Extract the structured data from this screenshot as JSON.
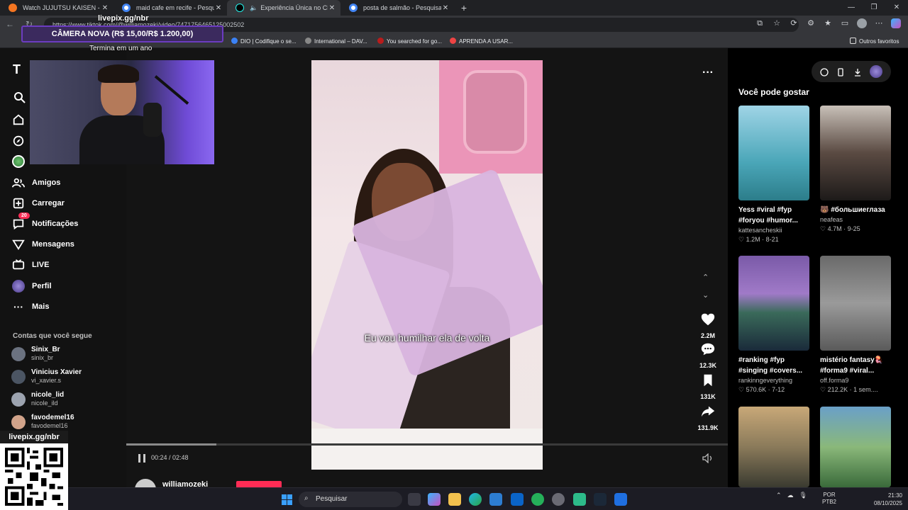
{
  "browser": {
    "tabs": [
      {
        "title": "Watch JUJUTSU KAISEN - Crunchyroll",
        "color": "#f47521",
        "active": false
      },
      {
        "title": "maid cafe em recife - Pesquisa Google",
        "color": "#4285f4",
        "active": false
      },
      {
        "title": "Experiência Única no Chest Club",
        "color": "#000000",
        "active": true
      },
      {
        "title": "posta de salmão - Pesquisa Google",
        "color": "#4285f4",
        "active": false
      }
    ],
    "new_tab": "+",
    "url": "https://www.tiktok.com/@williamozeki/video/7471756465125002502",
    "bookmarks": [
      {
        "label": "DIO | Codifique o se...",
        "color": "#3b82f6"
      },
      {
        "label": "International – DAV...",
        "color": "#888888"
      },
      {
        "label": "You searched for go...",
        "color": "#b91c1c"
      },
      {
        "label": "APRENDA A USAR...",
        "color": "#ef4444"
      }
    ],
    "other_favorites": "Outros favoritos"
  },
  "stream_overlay": {
    "site": "livepix.gg/nbr",
    "banner": "CÂMERA NOVA (R$ 15,00/R$ 1.200,00)",
    "subtext": "Termina em um ano",
    "qr_label": "livepix.gg/nbr"
  },
  "sidebar": {
    "logo": "T",
    "nav": [
      {
        "label": "Amigos",
        "icon": "friends-icon"
      },
      {
        "label": "Carregar",
        "icon": "upload-icon"
      },
      {
        "label": "Notificações",
        "icon": "notifications-icon",
        "badge": "20"
      },
      {
        "label": "Mensagens",
        "icon": "messages-icon"
      },
      {
        "label": "LIVE",
        "icon": "live-icon"
      },
      {
        "label": "Perfil",
        "icon": "profile-icon"
      },
      {
        "label": "Mais",
        "icon": "more-icon"
      }
    ],
    "following_title": "Contas que você segue",
    "accounts": [
      {
        "name": "Sinix_Br",
        "handle": "sinix_br",
        "color": "#6b7280"
      },
      {
        "name": "Vinicius Xavier",
        "handle": "vi_xavier.s",
        "color": "#4b5563"
      },
      {
        "name": "nicole_lid",
        "handle": "nicole_ild",
        "color": "#9ca3af"
      },
      {
        "name": "favodemel16",
        "handle": "favodemel16",
        "color": "#d1a38a"
      }
    ]
  },
  "video": {
    "caption": "Eu vou humilhar ela de volta",
    "time": "00:24 / 02:48",
    "progress": 0.15,
    "author": "williamozeki",
    "actions": {
      "likes": "2.2M",
      "comments": "12.3K",
      "saves": "131K",
      "shares": "131.9K"
    }
  },
  "suggestions": {
    "title": "Você pode gostar",
    "cards": [
      {
        "title": "Yess #viral #fyp #foryou #humor...",
        "user": "kattesancheskii",
        "likes": "1.2M",
        "date": "8-21",
        "c1": "#4aa6b8",
        "c2": "#2c7d8a"
      },
      {
        "title": "🐻 #большиеглаза",
        "user": "neafeas",
        "likes": "4.7M",
        "date": "9-25",
        "c1": "#5a4a42",
        "c2": "#1d1a19"
      },
      {
        "title": "#ranking #fyp #singing #covers...",
        "user": "rankinngeverything",
        "likes": "570.6K",
        "date": "7-12",
        "c1": "#7a5aa8",
        "c2": "#3a6a5a"
      },
      {
        "title": "mistério fantasy🪼 #forma9 #viral...",
        "user": "off.forma9",
        "likes": "212.2K",
        "date": "1 sem....",
        "c1": "#9a9a9a",
        "c2": "#5a5a5a"
      },
      {
        "title": "",
        "user": "",
        "likes": "",
        "date": "",
        "c1": "#8a7a5a",
        "c2": "#3a3a30"
      },
      {
        "title": "",
        "user": "",
        "likes": "",
        "date": "",
        "c1": "#6aa0c8",
        "c2": "#3a6a3a"
      }
    ]
  },
  "taskbar": {
    "search": "Pesquisar",
    "lang_1": "POR",
    "lang_2": "PTB2",
    "time": "21:30",
    "date": "08/10/2025"
  }
}
